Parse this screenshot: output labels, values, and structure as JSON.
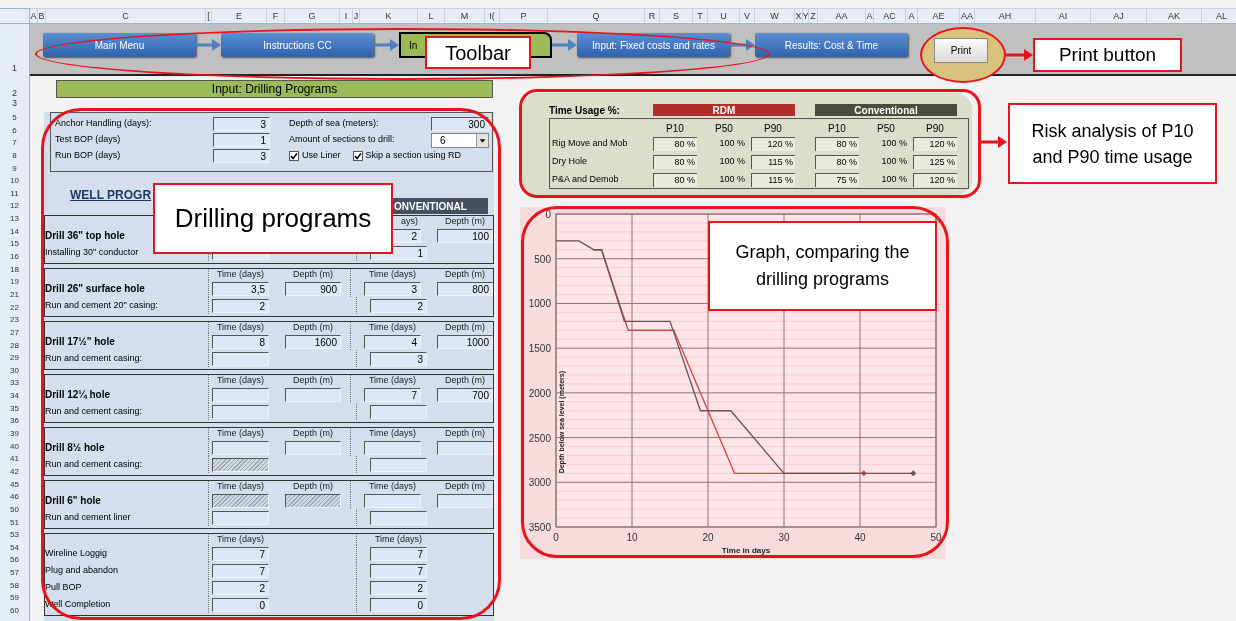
{
  "column_headers": [
    "A",
    "B",
    "C",
    "[",
    "E",
    "F",
    "G",
    "I",
    "J",
    "K",
    "L",
    "M",
    "I(",
    "P",
    "Q",
    "R",
    "S",
    "T",
    "U",
    "V",
    "W",
    "X",
    "Y",
    "Z",
    "AA",
    "A",
    "AC",
    "A",
    "AE",
    "AA",
    "AH",
    "AI",
    "AJ",
    "AK",
    "AL"
  ],
  "row_numbers": {
    "toolbar": "1",
    "heading": "2",
    "gap": "3",
    "rest": [
      "5",
      "6",
      "7",
      "8",
      "9",
      "10",
      "11",
      "12",
      "13",
      "14",
      "15",
      "16",
      "18",
      "19",
      "21",
      "22",
      "23",
      "27",
      "28",
      "29",
      "30",
      "33",
      "34",
      "35",
      "36",
      "39",
      "40",
      "41",
      "42",
      "45",
      "46",
      "50",
      "51",
      "53",
      "54",
      "56",
      "57",
      "58",
      "59",
      "60"
    ]
  },
  "toolbar": {
    "buttons": [
      {
        "label": "Main Menu",
        "kind": "nav"
      },
      {
        "label": "Instructions CC",
        "kind": "nav"
      },
      {
        "label": "In",
        "kind": "current"
      },
      {
        "label": "Input: Fixed costs and rates",
        "kind": "nav"
      },
      {
        "label": "Results: Cost & Time",
        "kind": "nav"
      }
    ],
    "print": "Print"
  },
  "title": "Input: Drilling Programs",
  "parameters": {
    "left": [
      {
        "label": "Anchor Handling (days):",
        "value": "3"
      },
      {
        "label": "Test BOP (days)",
        "value": "1"
      },
      {
        "label": "Run BOP (days)",
        "value": "3"
      }
    ],
    "depth": {
      "label": "Depth of sea (meters):",
      "value": "300"
    },
    "sections": {
      "label": "Amount of sections to drill:",
      "value": "6"
    },
    "checkboxes": [
      {
        "label": "Use Liner",
        "checked": true
      },
      {
        "label": "Skip a section using RD",
        "checked": true
      }
    ]
  },
  "well_program": {
    "heading": "WELL PROGR",
    "conventional_header": "ONVENTIONAL",
    "sections": [
      {
        "name": "Drill 36\" top hole",
        "sub_label": "Installing 30\" conductor",
        "headers": {
          "conv_time": "ays)",
          "conv_depth": "Depth (m)"
        },
        "fields": {
          "conv_time": {
            "value": "2",
            "hatched": false
          },
          "conv_depth": {
            "value": "100",
            "hatched": false
          },
          "rdm_sub": {
            "hatched": false
          },
          "conv_sub": {
            "value": "1",
            "hatched": false
          }
        }
      },
      {
        "name": "Drill 26\" surface hole",
        "sub_label": "Run and cement 20\" casing:",
        "headers": {
          "rdm_time": "Time (days)",
          "rdm_depth": "Depth (m)",
          "conv_time": "Time (days)",
          "conv_depth": "Depth (m)"
        },
        "fields": {
          "rdm_time": {
            "value": "3,5",
            "hatched": false
          },
          "rdm_depth": {
            "value": "900",
            "hatched": false
          },
          "conv_time": {
            "value": "3",
            "hatched": false
          },
          "conv_depth": {
            "value": "800",
            "hatched": false
          },
          "rdm_sub": {
            "value": "2",
            "hatched": false
          },
          "conv_sub": {
            "value": "2",
            "hatched": false
          }
        }
      },
      {
        "name": "Drill 17½\" hole",
        "sub_label": "Run and cement casing:",
        "headers": {
          "rdm_time": "Time (days)",
          "rdm_depth": "Depth (m)",
          "conv_time": "Time (days)",
          "conv_depth": "Depth (m)"
        },
        "fields": {
          "rdm_time": {
            "value": "8",
            "hatched": false
          },
          "rdm_depth": {
            "value": "1600",
            "hatched": false
          },
          "conv_time": {
            "value": "4",
            "hatched": false
          },
          "conv_depth": {
            "value": "1000",
            "hatched": false
          },
          "rdm_sub": {
            "hatched": false
          },
          "conv_sub": {
            "value": "3",
            "hatched": false
          }
        }
      },
      {
        "name": "Drill 12¼ hole",
        "sub_label": "Run and cement casing:",
        "headers": {
          "rdm_time": "Time (days)",
          "rdm_depth": "Depth (m)",
          "conv_time": "Time (days)",
          "conv_depth": "Depth (m)"
        },
        "fields": {
          "rdm_time": {
            "hatched": false
          },
          "rdm_depth": {
            "hatched": false
          },
          "conv_time": {
            "value": "7",
            "hatched": false
          },
          "conv_depth": {
            "value": "700",
            "hatched": false
          },
          "rdm_sub": {
            "hatched": false
          },
          "conv_sub": {
            "hatched": false
          }
        }
      },
      {
        "name": "Drill 8½ hole",
        "sub_label": "Run and cement casing:",
        "headers": {
          "rdm_time": "Time (days)",
          "rdm_depth": "Depth (m)",
          "conv_time": "Time (days)",
          "conv_depth": "Depth (m)"
        },
        "fields": {
          "rdm_time": {
            "hatched": false
          },
          "rdm_depth": {
            "hatched": false
          },
          "conv_time": {
            "hatched": false
          },
          "conv_depth": {
            "hatched": false
          },
          "rdm_sub": {
            "hatched": true
          },
          "conv_sub": {
            "hatched": false
          }
        }
      },
      {
        "name": "Drill 6\" hole",
        "sub_label": "Run and cement liner",
        "headers": {
          "rdm_time": "Time (days)",
          "rdm_depth": "Depth (m)",
          "conv_time": "Time (days)",
          "conv_depth": "Depth (m)"
        },
        "fields": {
          "rdm_time": {
            "hatched": true
          },
          "rdm_depth": {
            "hatched": true
          },
          "conv_time": {
            "hatched": false
          },
          "conv_depth": {
            "hatched": false
          },
          "rdm_sub": {
            "hatched": false
          },
          "conv_sub": {
            "hatched": false
          }
        }
      }
    ],
    "final": {
      "headers": [
        "Time (days)",
        "Time (days)"
      ],
      "rows": [
        {
          "label": "Wireline Loggig",
          "rdm": "7",
          "conv": "7"
        },
        {
          "label": "Plug and abandon",
          "rdm": "7",
          "conv": "7"
        },
        {
          "label": "Pull BOP",
          "rdm": "2",
          "conv": "2"
        },
        {
          "label": "Well Completion",
          "rdm": "0",
          "conv": "0"
        }
      ]
    }
  },
  "time_usage": {
    "title": "Time Usage %:",
    "groups": [
      {
        "name": "RDM",
        "color": "#b0302c",
        "headers": [
          "P10",
          "P50",
          "P90"
        ]
      },
      {
        "name": "Conventional",
        "color": "#4a4c3b",
        "headers": [
          "P10",
          "P50",
          "P90"
        ]
      }
    ],
    "rows": [
      {
        "label": "Rig Move and Mob",
        "values": [
          "80 %",
          "100 %",
          "120 %",
          "80 %",
          "100 %",
          "120 %"
        ]
      },
      {
        "label": "Dry Hole",
        "values": [
          "80 %",
          "100 %",
          "115 %",
          "80 %",
          "100 %",
          "125 %"
        ]
      },
      {
        "label": "P&A and Demob",
        "values": [
          "80 %",
          "100 %",
          "115 %",
          "75 %",
          "100 %",
          "120 %"
        ]
      }
    ]
  },
  "chart": {
    "chart_data": {
      "type": "line",
      "grid": true,
      "xlabel": "Time in days",
      "ylabel": "Depth below sea level (meters)",
      "xlim": [
        0,
        50
      ],
      "ylim": [
        3500,
        0
      ],
      "xticks": [
        0,
        10,
        20,
        30,
        40,
        50
      ],
      "yticks": [
        0,
        500,
        1000,
        1500,
        2000,
        2500,
        3000,
        3500
      ],
      "ref_lines": [
        {
          "axis": "y",
          "value": 100
        },
        {
          "axis": "y",
          "value": 200
        },
        {
          "axis": "y",
          "value": 300
        },
        {
          "axis": "y",
          "value": 400
        },
        {
          "axis": "y",
          "value": 600
        },
        {
          "axis": "y",
          "value": 700
        },
        {
          "axis": "y",
          "value": 800
        },
        {
          "axis": "y",
          "value": 900
        },
        {
          "axis": "y",
          "value": 1100
        },
        {
          "axis": "y",
          "value": 1200
        },
        {
          "axis": "y",
          "value": 1300
        },
        {
          "axis": "y",
          "value": 1400
        },
        {
          "axis": "y",
          "value": 1600
        },
        {
          "axis": "y",
          "value": 1700
        },
        {
          "axis": "y",
          "value": 1800
        },
        {
          "axis": "y",
          "value": 1900
        },
        {
          "axis": "y",
          "value": 2100
        },
        {
          "axis": "y",
          "value": 2200
        },
        {
          "axis": "y",
          "value": 2300
        },
        {
          "axis": "y",
          "value": 2400
        },
        {
          "axis": "y",
          "value": 2600
        },
        {
          "axis": "y",
          "value": 2700
        },
        {
          "axis": "y",
          "value": 2800
        },
        {
          "axis": "y",
          "value": 2900
        },
        {
          "axis": "y",
          "value": 3100
        },
        {
          "axis": "y",
          "value": 3200
        },
        {
          "axis": "y",
          "value": 3300
        },
        {
          "axis": "y",
          "value": 3400
        }
      ],
      "series": [
        {
          "color": "#d04848",
          "x": [
            5,
            6,
            9.5,
            15.5,
            23.5,
            40.5
          ],
          "values": [
            400,
            400,
            1300,
            1300,
            2900,
            2900
          ]
        },
        {
          "color": "#6e5052",
          "x": [
            0,
            3,
            5,
            6,
            9,
            15,
            19,
            23,
            30,
            47
          ],
          "values": [
            300,
            300,
            400,
            400,
            1200,
            1200,
            2200,
            2200,
            2900,
            2900
          ]
        }
      ]
    }
  },
  "annotations": [
    {
      "kind": "toolbar",
      "text": "Toolbar"
    },
    {
      "kind": "print",
      "text": "Print button"
    },
    {
      "kind": "drilling",
      "text": "Drilling programs"
    },
    {
      "kind": "risk",
      "text": "Risk analysis of P10 and P90 time usage"
    },
    {
      "kind": "graph",
      "text": "Graph, comparing the drilling programs"
    }
  ]
}
